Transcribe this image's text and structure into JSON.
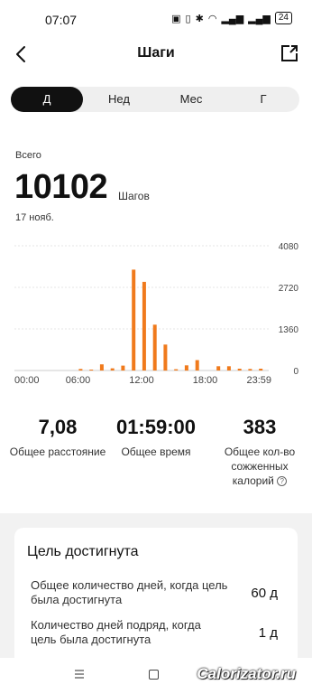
{
  "status": {
    "time": "07:07",
    "icons": [
      "nfc-icon",
      "vibrate-icon",
      "bluetooth-icon",
      "wifi-icon",
      "signal-icon",
      "signal-icon"
    ],
    "battery": "24"
  },
  "header": {
    "title": "Шаги"
  },
  "tabs": [
    {
      "label": "Д",
      "active": true
    },
    {
      "label": "Нед",
      "active": false
    },
    {
      "label": "Мес",
      "active": false
    },
    {
      "label": "Г",
      "active": false
    }
  ],
  "summary": {
    "label": "Всего",
    "value": "10102",
    "unit": "Шагов",
    "date": "17 нояб."
  },
  "chart_data": {
    "type": "bar",
    "x": [
      "00:00",
      "00:30",
      "01:00",
      "01:30",
      "02:00",
      "02:30",
      "03:00",
      "03:30",
      "04:00",
      "04:30",
      "05:00",
      "05:30",
      "06:00",
      "06:30",
      "07:00",
      "07:30",
      "08:00",
      "08:30",
      "09:00",
      "09:30",
      "10:00",
      "10:30",
      "11:00",
      "11:30",
      "12:00",
      "12:30",
      "13:00",
      "13:30",
      "14:00",
      "14:30",
      "15:00",
      "15:30",
      "16:00",
      "16:30",
      "17:00",
      "17:30",
      "18:00",
      "18:30",
      "19:00",
      "19:30",
      "20:00",
      "20:30",
      "21:00",
      "21:30",
      "22:00",
      "22:30",
      "23:00",
      "23:30"
    ],
    "values": [
      0,
      0,
      0,
      0,
      0,
      0,
      0,
      0,
      0,
      0,
      0,
      0,
      50,
      0,
      30,
      0,
      200,
      0,
      70,
      0,
      160,
      0,
      3300,
      0,
      2900,
      0,
      1500,
      0,
      850,
      0,
      40,
      0,
      170,
      0,
      340,
      0,
      0,
      0,
      140,
      0,
      140,
      0,
      60,
      0,
      50,
      0,
      60,
      0
    ],
    "xticks": [
      "00:00",
      "06:00",
      "12:00",
      "18:00",
      "23:59"
    ],
    "yticks": [
      "0",
      "1360",
      "2720",
      "4080"
    ],
    "ylim": [
      0,
      4080
    ],
    "grid": true,
    "color": "#f07a1c"
  },
  "stats": [
    {
      "value": "7,08",
      "label": "Общее расстояние"
    },
    {
      "value": "01:59:00",
      "label": "Общее время"
    },
    {
      "value": "383",
      "label": "Общее кол-во сожженных калорий"
    }
  ],
  "goal": {
    "title": "Цель достигнута",
    "rows": [
      {
        "label": "Общее количество дней, когда цель была достигнута",
        "value": "60 д"
      },
      {
        "label": "Количество дней подряд, когда цель была достигнута",
        "value": "1 д"
      }
    ]
  },
  "watermark": "Calorizator.ru"
}
